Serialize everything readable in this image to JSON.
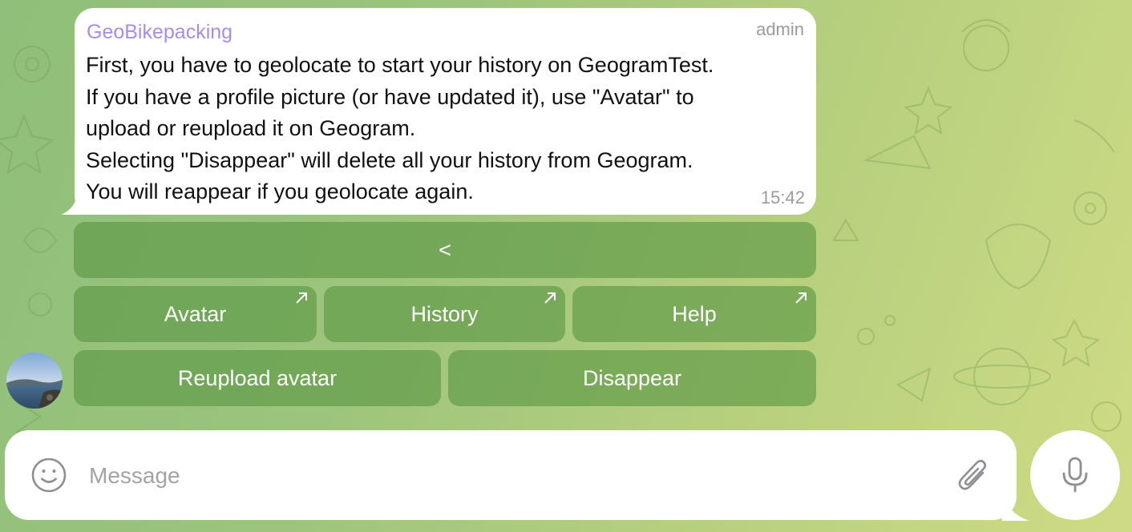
{
  "message": {
    "sender": "GeoBikepacking",
    "role": "admin",
    "lines": [
      "First, you have to geolocate to start your history on GeogramTest.",
      "If you have a profile picture (or have updated it), use \"Avatar\" to",
      "upload or reupload it on Geogram.",
      "Selecting \"Disappear\" will delete all your history from Geogram.",
      "You will reappear if you geolocate again."
    ],
    "time": "15:42"
  },
  "keyboard": {
    "back_label": "<",
    "avatar_label": "Avatar",
    "history_label": "History",
    "help_label": "Help",
    "reupload_label": "Reupload avatar",
    "disappear_label": "Disappear",
    "link_icon": "arrow-up-right-icon"
  },
  "composer": {
    "placeholder": "Message",
    "emoji_icon": "smiley-icon",
    "attach_icon": "paperclip-icon",
    "mic_icon": "microphone-icon"
  },
  "colors": {
    "sender": "#a88ce6",
    "button_bg": "#5e9a48",
    "meta_text": "#9b9b9b"
  }
}
